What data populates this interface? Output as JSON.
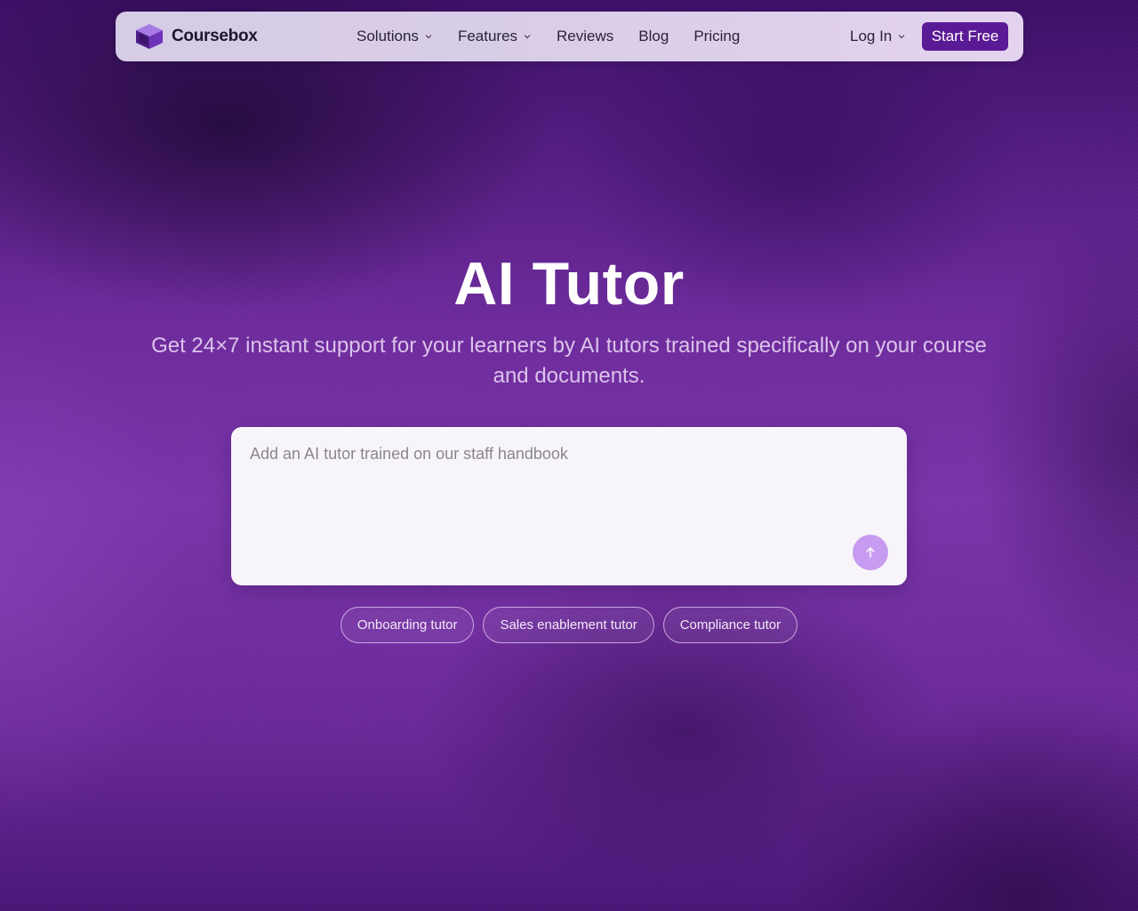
{
  "brand": {
    "name": "Coursebox",
    "logo_icon": "cube-logo-icon"
  },
  "nav": {
    "items": [
      {
        "label": "Solutions",
        "has_dropdown": true
      },
      {
        "label": "Features",
        "has_dropdown": true
      },
      {
        "label": "Reviews",
        "has_dropdown": false
      },
      {
        "label": "Blog",
        "has_dropdown": false
      },
      {
        "label": "Pricing",
        "has_dropdown": false
      }
    ],
    "login_label": "Log In",
    "cta_label": "Start Free"
  },
  "hero": {
    "title": "AI Tutor",
    "subtitle": "Get 24×7 instant support for your learners by AI tutors trained specifically on your course and documents."
  },
  "prompt": {
    "placeholder": "Add an AI tutor trained on our staff handbook",
    "value": "",
    "send_icon": "arrow-up-icon"
  },
  "suggestions": [
    "Onboarding tutor",
    "Sales enablement tutor",
    "Compliance tutor"
  ],
  "colors": {
    "accent": "#5b1a95",
    "send_button": "#c79cf0",
    "background": "#7a34aa"
  }
}
